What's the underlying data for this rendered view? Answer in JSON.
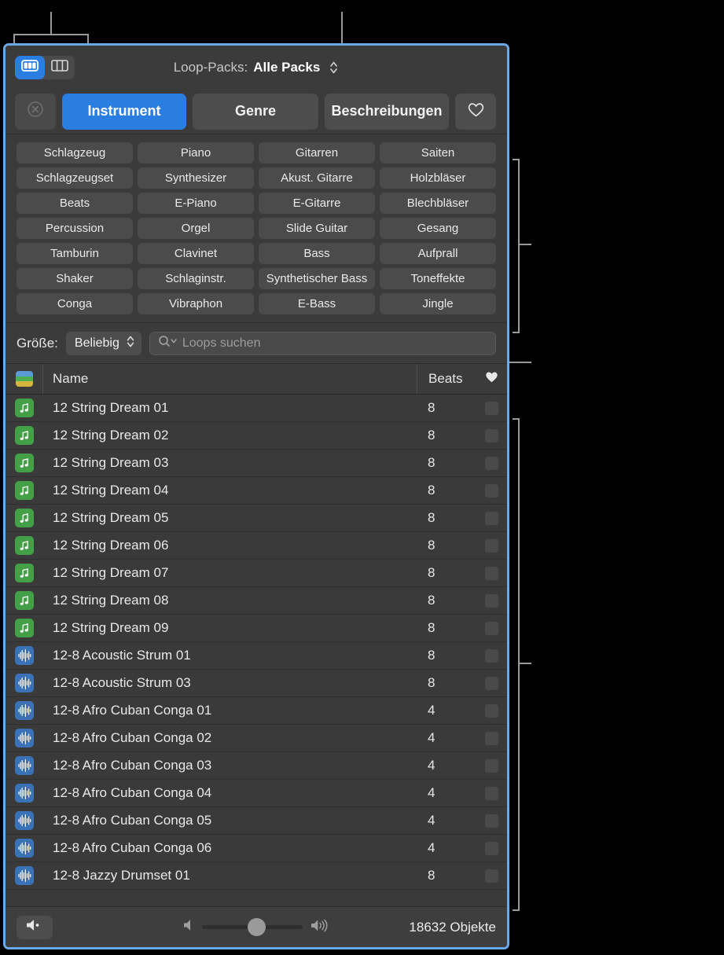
{
  "window": {
    "accent_border": "#6aa9e8",
    "background": "#3b3b3b"
  },
  "topbar": {
    "view_grid_icon": "grid-columns-filled-icon",
    "view_list_icon": "grid-columns-outline-icon",
    "looppacks_label": "Loop-Packs:",
    "looppacks_value": "Alle Packs",
    "stepper_icon": "stepper-up-down-icon"
  },
  "tabs": {
    "clear_icon": "circle-x-icon",
    "items": [
      {
        "label": "Instrument",
        "active": true
      },
      {
        "label": "Genre",
        "active": false
      },
      {
        "label": "Beschreibungen",
        "active": false
      }
    ],
    "favorite_icon": "heart-outline-icon"
  },
  "keywords": [
    "Schlagzeug",
    "Piano",
    "Gitarren",
    "Saiten",
    "Schlagzeugset",
    "Synthesizer",
    "Akust. Gitarre",
    "Holzbläser",
    "Beats",
    "E-Piano",
    "E-Gitarre",
    "Blechbläser",
    "Percussion",
    "Orgel",
    "Slide Guitar",
    "Gesang",
    "Tamburin",
    "Clavinet",
    "Bass",
    "Aufprall",
    "Shaker",
    "Schlaginstr.",
    "Synthetischer Bass",
    "Toneffekte",
    "Conga",
    "Vibraphon",
    "E-Bass",
    "Jingle"
  ],
  "searchrow": {
    "size_label": "Größe:",
    "size_value": "Beliebig",
    "size_stepper_icon": "stepper-up-down-icon",
    "search_icon": "search-icon",
    "search_value": "",
    "search_placeholder": "Loops suchen"
  },
  "list_header": {
    "type_icon": "color-stripes-icon",
    "name": "Name",
    "beats": "Beats",
    "favorite_icon": "heart-filled-icon"
  },
  "rows": [
    {
      "kind": "midi",
      "name": "12 String Dream 01",
      "beats": "8"
    },
    {
      "kind": "midi",
      "name": "12 String Dream 02",
      "beats": "8"
    },
    {
      "kind": "midi",
      "name": "12 String Dream 03",
      "beats": "8"
    },
    {
      "kind": "midi",
      "name": "12 String Dream 04",
      "beats": "8"
    },
    {
      "kind": "midi",
      "name": "12 String Dream 05",
      "beats": "8"
    },
    {
      "kind": "midi",
      "name": "12 String Dream 06",
      "beats": "8"
    },
    {
      "kind": "midi",
      "name": "12 String Dream 07",
      "beats": "8"
    },
    {
      "kind": "midi",
      "name": "12 String Dream 08",
      "beats": "8"
    },
    {
      "kind": "midi",
      "name": "12 String Dream 09",
      "beats": "8"
    },
    {
      "kind": "audio",
      "name": "12-8 Acoustic Strum 01",
      "beats": "8"
    },
    {
      "kind": "audio",
      "name": "12-8 Acoustic Strum 03",
      "beats": "8"
    },
    {
      "kind": "audio",
      "name": "12-8 Afro Cuban Conga 01",
      "beats": "4"
    },
    {
      "kind": "audio",
      "name": "12-8 Afro Cuban Conga 02",
      "beats": "4"
    },
    {
      "kind": "audio",
      "name": "12-8 Afro Cuban Conga 03",
      "beats": "4"
    },
    {
      "kind": "audio",
      "name": "12-8 Afro Cuban Conga 04",
      "beats": "4"
    },
    {
      "kind": "audio",
      "name": "12-8 Afro Cuban Conga 05",
      "beats": "4"
    },
    {
      "kind": "audio",
      "name": "12-8 Afro Cuban Conga 06",
      "beats": "4"
    },
    {
      "kind": "audio",
      "name": "12-8 Jazzy Drumset 01",
      "beats": "8"
    }
  ],
  "footer": {
    "mute_icon": "speaker-mute-icon",
    "volume_low_icon": "speaker-low-icon",
    "volume_high_icon": "speaker-high-icon",
    "volume_percent": 50,
    "count": "18632 Objekte"
  }
}
